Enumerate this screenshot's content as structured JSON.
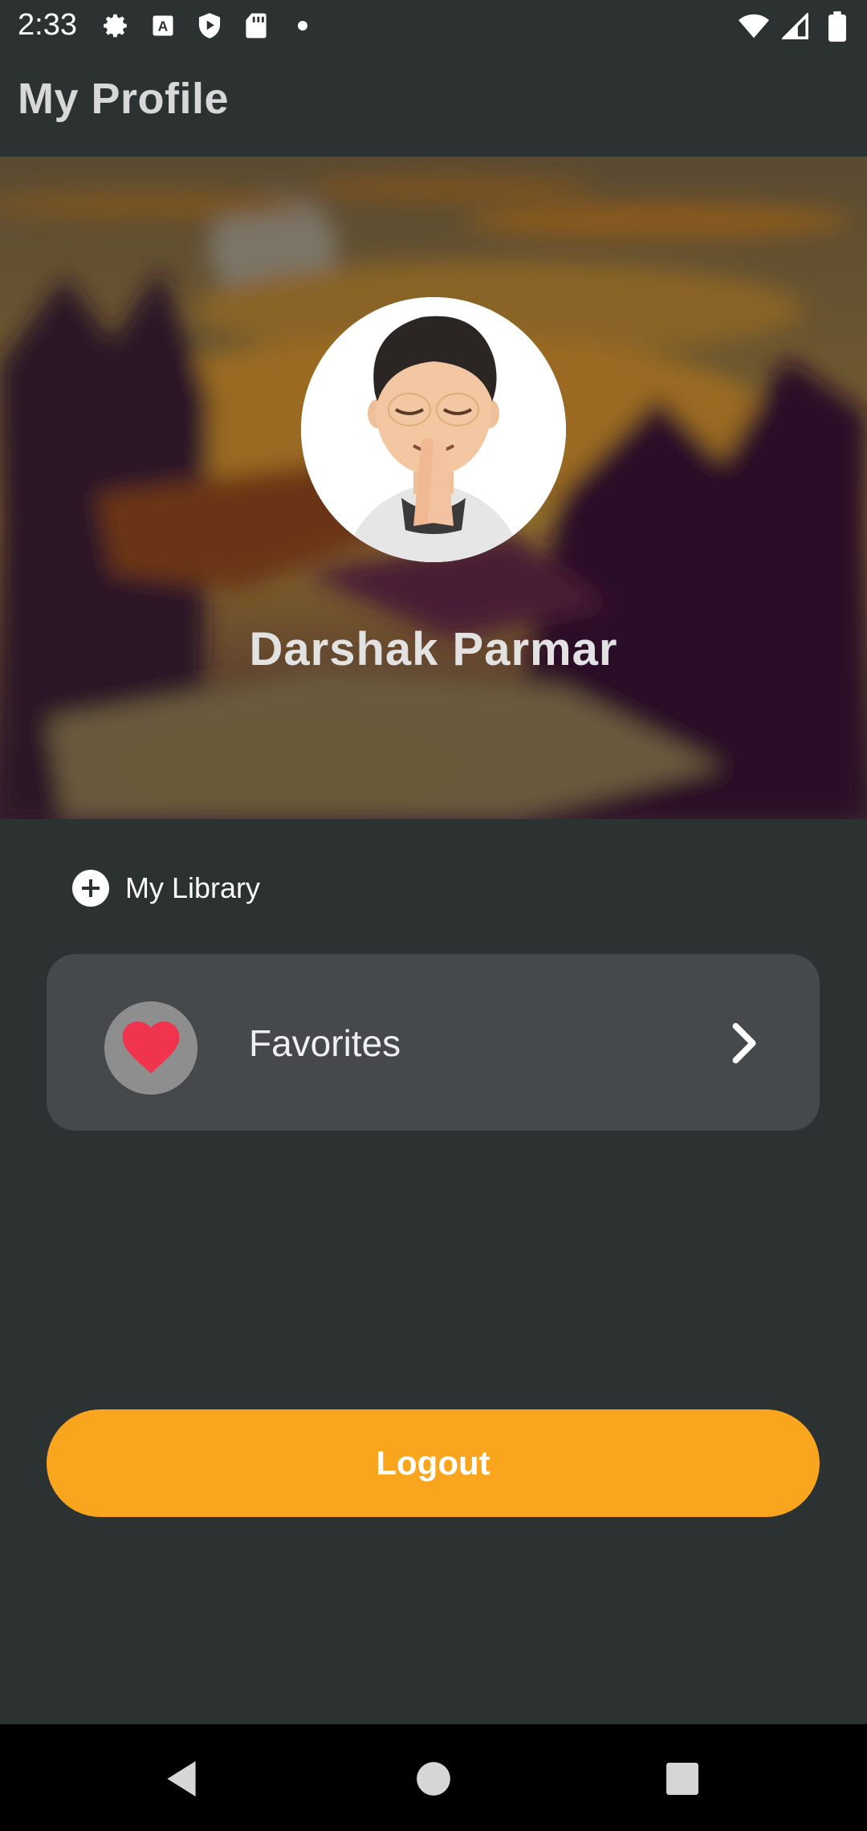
{
  "status_bar": {
    "time": "2:33",
    "left_icons": [
      "gear-icon",
      "font-a-icon",
      "play-shield-icon",
      "sd-card-icon",
      "dot-icon"
    ],
    "right_icons": [
      "wifi-icon",
      "signal-icon",
      "battery-icon"
    ]
  },
  "app_bar": {
    "title": "My Profile"
  },
  "profile": {
    "name": "Darshak Parmar",
    "avatar_icon": "memoji-avatar"
  },
  "library": {
    "label": "My Library",
    "icon": "plus-circle-icon"
  },
  "favorites": {
    "label": "Favorites",
    "icon": "heart-icon",
    "chevron": "chevron-right-icon"
  },
  "logout": {
    "label": "Logout"
  },
  "nav_bar": {
    "buttons": [
      "back-icon",
      "home-icon",
      "recents-icon"
    ]
  },
  "colors": {
    "background": "#2c3132",
    "card": "#45494b",
    "accent": "#f9a51e",
    "heart": "#f0344e"
  }
}
